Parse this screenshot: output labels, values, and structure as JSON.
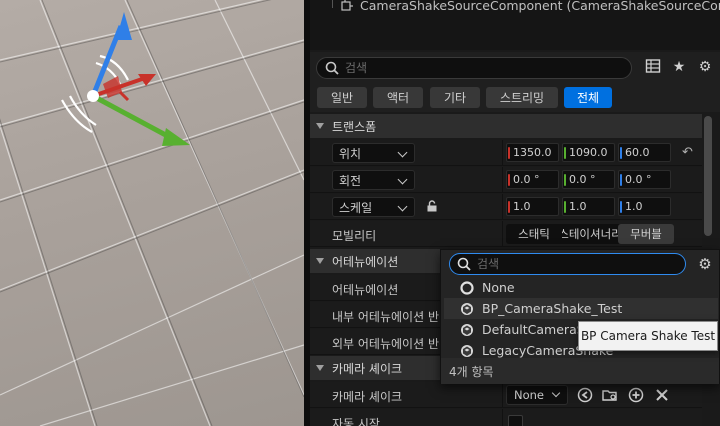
{
  "component_tree": {
    "item_label": "CameraShakeSourceComponent (CameraShakeSourceCom"
  },
  "search": {
    "placeholder": "검색"
  },
  "filters": [
    "일반",
    "액터",
    "기타",
    "스트리밍",
    "전체"
  ],
  "active_filter": "전체",
  "categories": {
    "transform": "트랜스폼",
    "attenuation": "어테뉴에이션",
    "camera_shake": "카메라 셰이크"
  },
  "transform": {
    "location": {
      "label": "위치",
      "x": "1350.0",
      "y": "1090.0",
      "z": "60.0"
    },
    "rotation": {
      "label": "회전",
      "x": "0.0 °",
      "y": "0.0 °",
      "z": "0.0 °"
    },
    "scale": {
      "label": "스케일",
      "x": "1.0",
      "y": "1.0",
      "z": "1.0"
    },
    "mobility": {
      "label": "모빌리티",
      "options": [
        "스태틱",
        "스테이셔너리",
        "무버블"
      ],
      "selected": "무버블"
    }
  },
  "attenuation": {
    "rows": [
      "어테뉴에이션",
      "내부 어테뉴에이션 반경",
      "외부 어테뉴에이션 반경"
    ]
  },
  "camera_shake": {
    "shake_label": "카메라 셰이크",
    "shake_value": "None",
    "auto_start_label": "자동 시작"
  },
  "popup": {
    "search_placeholder": "검색",
    "items": [
      "None",
      "BP_CameraShake_Test",
      "DefaultCameraShake",
      "LegacyCameraShake"
    ],
    "footer": "4개 항목"
  },
  "tooltip": "BP Camera Shake Test",
  "colors": {
    "accent": "#0070e0",
    "axis_x": "#c8322a",
    "axis_y": "#58b030",
    "axis_z": "#2f7fe8"
  },
  "icons": [
    "search-icon",
    "table-icon",
    "star-icon",
    "gear-icon",
    "reset-arrow-icon",
    "lock-icon",
    "browse-arrow-icon",
    "folder-icon",
    "add-icon",
    "clear-icon",
    "none-circle-icon",
    "blueprint-class-icon"
  ]
}
